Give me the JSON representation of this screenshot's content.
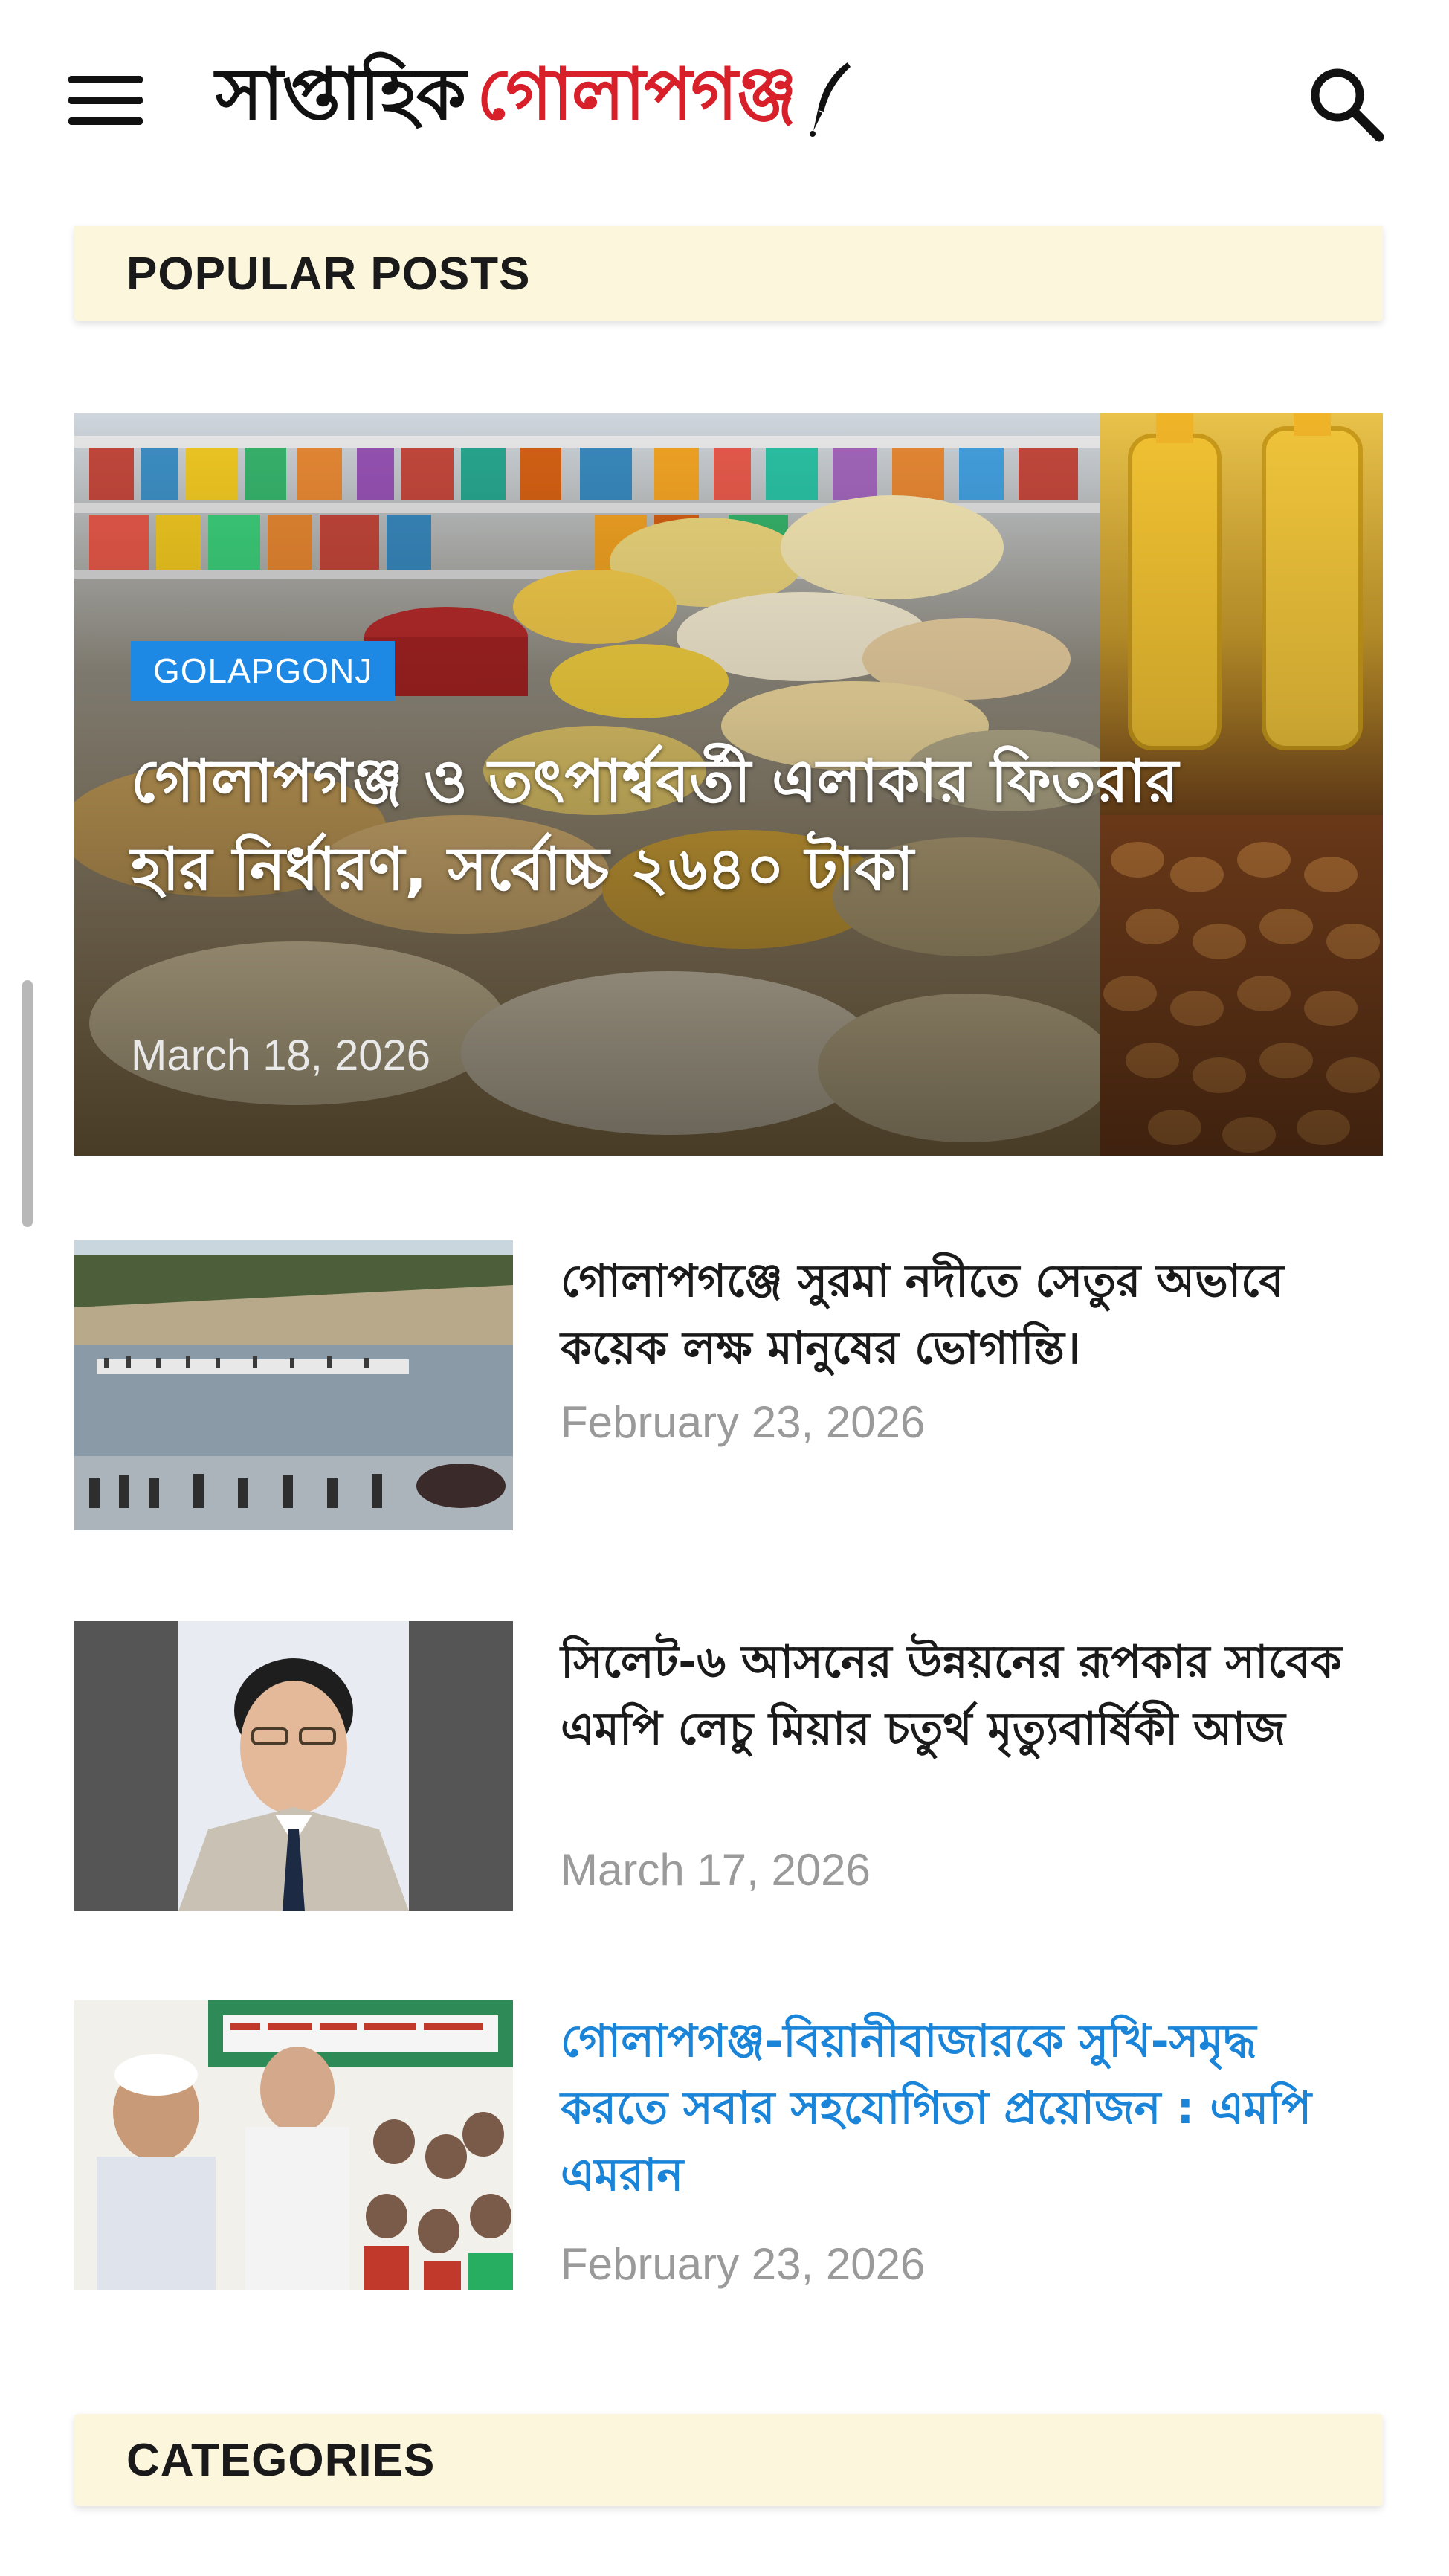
{
  "header": {
    "logo_part1": "সাপ্তাহিক",
    "logo_part2": "গোলাপগঞ্জ",
    "menu_icon": "hamburger-menu-icon",
    "search_icon": "search-icon"
  },
  "popular": {
    "heading": "POPULAR POSTS"
  },
  "featured": {
    "category": "GOLAPGONJ",
    "title": "গোলাপগঞ্জ ও তৎপার্শ্ববর্তী এলাকার ফিতরার হার নির্ধারণ, সর্বোচ্চ ২৬৪০ টাকা",
    "date": "March 18, 2026"
  },
  "posts": [
    {
      "title": "গোলাপগঞ্জে সুরমা নদীতে সেতুর অভাবে কয়েক লক্ষ মানুষের ভোগান্তি।",
      "date": "February 23, 2026"
    },
    {
      "title": "সিলেট-৬ আসনের উন্নয়নের রূপকার সাবেক এমপি লেচু মিয়ার চতুর্থ মৃত্যুবার্ষিকী আজ",
      "date": "March 17, 2026"
    },
    {
      "title": "গোলাপগঞ্জ-বিয়ানীবাজারকে সুখি-সমৃদ্ধ করতে সবার সহযোগিতা প্রয়োজন : এমপি এমরান",
      "date": "February 23, 2026"
    }
  ],
  "categories": {
    "heading": "CATEGORIES"
  },
  "colors": {
    "accent_blue": "#1e88e5",
    "link_blue": "#1a84d8",
    "logo_red": "#d8202a",
    "header_bg": "#fcf6dc"
  }
}
